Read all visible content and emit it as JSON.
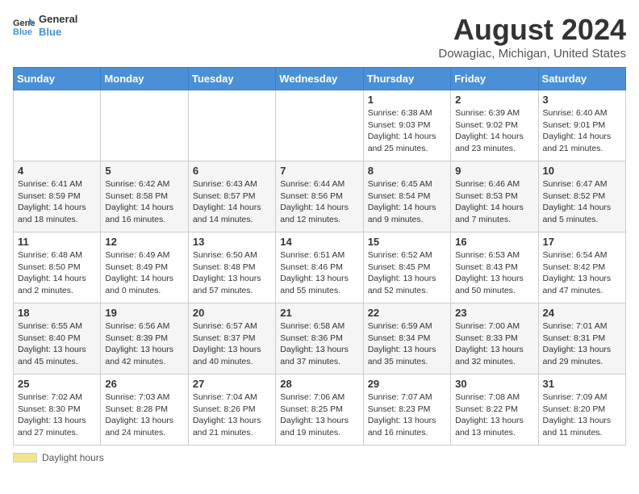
{
  "header": {
    "logo_line1": "General",
    "logo_line2": "Blue",
    "title": "August 2024",
    "subtitle": "Dowagiac, Michigan, United States"
  },
  "days_of_week": [
    "Sunday",
    "Monday",
    "Tuesday",
    "Wednesday",
    "Thursday",
    "Friday",
    "Saturday"
  ],
  "weeks": [
    [
      {
        "num": "",
        "info": ""
      },
      {
        "num": "",
        "info": ""
      },
      {
        "num": "",
        "info": ""
      },
      {
        "num": "",
        "info": ""
      },
      {
        "num": "1",
        "info": "Sunrise: 6:38 AM\nSunset: 9:03 PM\nDaylight: 14 hours and 25 minutes."
      },
      {
        "num": "2",
        "info": "Sunrise: 6:39 AM\nSunset: 9:02 PM\nDaylight: 14 hours and 23 minutes."
      },
      {
        "num": "3",
        "info": "Sunrise: 6:40 AM\nSunset: 9:01 PM\nDaylight: 14 hours and 21 minutes."
      }
    ],
    [
      {
        "num": "4",
        "info": "Sunrise: 6:41 AM\nSunset: 8:59 PM\nDaylight: 14 hours and 18 minutes."
      },
      {
        "num": "5",
        "info": "Sunrise: 6:42 AM\nSunset: 8:58 PM\nDaylight: 14 hours and 16 minutes."
      },
      {
        "num": "6",
        "info": "Sunrise: 6:43 AM\nSunset: 8:57 PM\nDaylight: 14 hours and 14 minutes."
      },
      {
        "num": "7",
        "info": "Sunrise: 6:44 AM\nSunset: 8:56 PM\nDaylight: 14 hours and 12 minutes."
      },
      {
        "num": "8",
        "info": "Sunrise: 6:45 AM\nSunset: 8:54 PM\nDaylight: 14 hours and 9 minutes."
      },
      {
        "num": "9",
        "info": "Sunrise: 6:46 AM\nSunset: 8:53 PM\nDaylight: 14 hours and 7 minutes."
      },
      {
        "num": "10",
        "info": "Sunrise: 6:47 AM\nSunset: 8:52 PM\nDaylight: 14 hours and 5 minutes."
      }
    ],
    [
      {
        "num": "11",
        "info": "Sunrise: 6:48 AM\nSunset: 8:50 PM\nDaylight: 14 hours and 2 minutes."
      },
      {
        "num": "12",
        "info": "Sunrise: 6:49 AM\nSunset: 8:49 PM\nDaylight: 14 hours and 0 minutes."
      },
      {
        "num": "13",
        "info": "Sunrise: 6:50 AM\nSunset: 8:48 PM\nDaylight: 13 hours and 57 minutes."
      },
      {
        "num": "14",
        "info": "Sunrise: 6:51 AM\nSunset: 8:46 PM\nDaylight: 13 hours and 55 minutes."
      },
      {
        "num": "15",
        "info": "Sunrise: 6:52 AM\nSunset: 8:45 PM\nDaylight: 13 hours and 52 minutes."
      },
      {
        "num": "16",
        "info": "Sunrise: 6:53 AM\nSunset: 8:43 PM\nDaylight: 13 hours and 50 minutes."
      },
      {
        "num": "17",
        "info": "Sunrise: 6:54 AM\nSunset: 8:42 PM\nDaylight: 13 hours and 47 minutes."
      }
    ],
    [
      {
        "num": "18",
        "info": "Sunrise: 6:55 AM\nSunset: 8:40 PM\nDaylight: 13 hours and 45 minutes."
      },
      {
        "num": "19",
        "info": "Sunrise: 6:56 AM\nSunset: 8:39 PM\nDaylight: 13 hours and 42 minutes."
      },
      {
        "num": "20",
        "info": "Sunrise: 6:57 AM\nSunset: 8:37 PM\nDaylight: 13 hours and 40 minutes."
      },
      {
        "num": "21",
        "info": "Sunrise: 6:58 AM\nSunset: 8:36 PM\nDaylight: 13 hours and 37 minutes."
      },
      {
        "num": "22",
        "info": "Sunrise: 6:59 AM\nSunset: 8:34 PM\nDaylight: 13 hours and 35 minutes."
      },
      {
        "num": "23",
        "info": "Sunrise: 7:00 AM\nSunset: 8:33 PM\nDaylight: 13 hours and 32 minutes."
      },
      {
        "num": "24",
        "info": "Sunrise: 7:01 AM\nSunset: 8:31 PM\nDaylight: 13 hours and 29 minutes."
      }
    ],
    [
      {
        "num": "25",
        "info": "Sunrise: 7:02 AM\nSunset: 8:30 PM\nDaylight: 13 hours and 27 minutes."
      },
      {
        "num": "26",
        "info": "Sunrise: 7:03 AM\nSunset: 8:28 PM\nDaylight: 13 hours and 24 minutes."
      },
      {
        "num": "27",
        "info": "Sunrise: 7:04 AM\nSunset: 8:26 PM\nDaylight: 13 hours and 21 minutes."
      },
      {
        "num": "28",
        "info": "Sunrise: 7:06 AM\nSunset: 8:25 PM\nDaylight: 13 hours and 19 minutes."
      },
      {
        "num": "29",
        "info": "Sunrise: 7:07 AM\nSunset: 8:23 PM\nDaylight: 13 hours and 16 minutes."
      },
      {
        "num": "30",
        "info": "Sunrise: 7:08 AM\nSunset: 8:22 PM\nDaylight: 13 hours and 13 minutes."
      },
      {
        "num": "31",
        "info": "Sunrise: 7:09 AM\nSunset: 8:20 PM\nDaylight: 13 hours and 11 minutes."
      }
    ]
  ],
  "legend": {
    "label": "Daylight hours"
  }
}
